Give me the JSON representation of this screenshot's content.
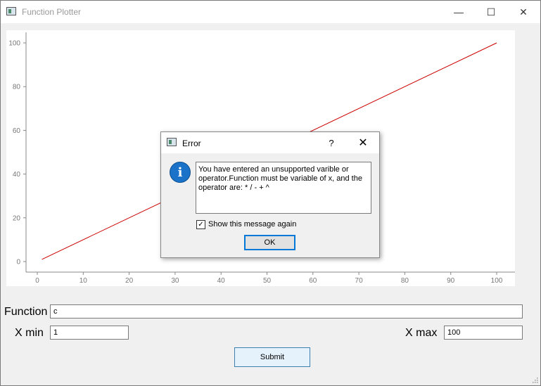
{
  "window": {
    "title": "Function Plotter",
    "minimize_glyph": "—",
    "maximize_glyph": "☐",
    "close_glyph": "✕"
  },
  "form": {
    "function_label": "Function",
    "function_value": "c",
    "xmin_label": "X min",
    "xmin_value": "1",
    "xmax_label": "X max",
    "xmax_value": "100",
    "submit_label": "Submit"
  },
  "dialog": {
    "title": "Error",
    "help_glyph": "?",
    "close_glyph": "✕",
    "info_glyph": "i",
    "message": "You have entered an unsupported varible or operator.Function must be variable of x, and the operator are: * / - + ^",
    "checkbox_label": "Show this message again",
    "checkbox_checked": true,
    "ok_label": "OK"
  },
  "chart_data": {
    "type": "line",
    "title": "",
    "xlabel": "",
    "ylabel": "",
    "xlim": [
      0,
      100
    ],
    "ylim": [
      0,
      100
    ],
    "xticks": [
      0,
      10,
      20,
      30,
      40,
      50,
      60,
      70,
      80,
      90,
      100
    ],
    "yticks": [
      0,
      20,
      40,
      60,
      80,
      100
    ],
    "grid": false,
    "series": [
      {
        "color": "#cc0000",
        "x": [
          1,
          100
        ],
        "y": [
          1,
          100
        ]
      }
    ]
  }
}
